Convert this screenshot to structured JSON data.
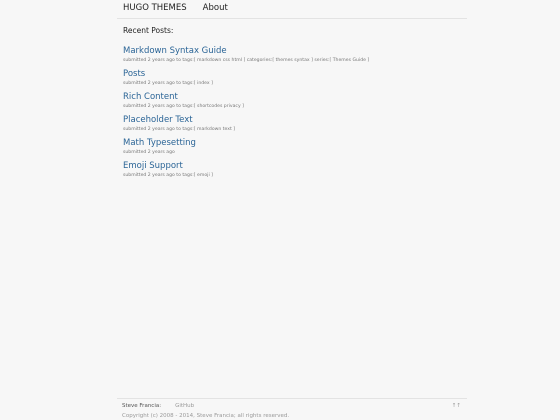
{
  "header": {
    "brand": "HUGO THEMES",
    "nav": [
      {
        "label": "About"
      }
    ]
  },
  "main": {
    "section_title": "Recent Posts:",
    "posts": [
      {
        "title": "Markdown Syntax Guide",
        "meta": "submitted 2 years ago to tags:[ markdown css html ] categories:[ themes syntax ] series:[ Themes Guide ]"
      },
      {
        "title": "Posts",
        "meta": "submitted 2 years ago to tags:[ index ]"
      },
      {
        "title": "Rich Content",
        "meta": "submitted 2 years ago to tags:[ shortcodes privacy ]"
      },
      {
        "title": "Placeholder Text",
        "meta": "submitted 2 years ago to tags:[ markdown text ]"
      },
      {
        "title": "Math Typesetting",
        "meta": "submitted 2 years ago"
      },
      {
        "title": "Emoji Support",
        "meta": "submitted 2 years ago to tags:[ emoji ]"
      }
    ]
  },
  "footer": {
    "author": "Steve Francia:",
    "github": "GitHub",
    "top_link": "↑↑",
    "copyright": "Copyright (c) 2008 - 2014, Steve Francia; all rights reserved."
  },
  "colors": {
    "link": "#2a6496",
    "background": "#f7f7f7",
    "text": "#333333",
    "muted": "#777777"
  }
}
